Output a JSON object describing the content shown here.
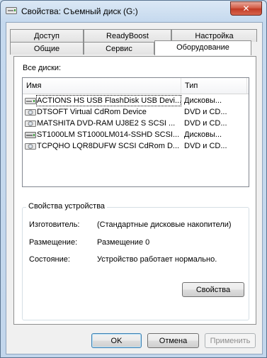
{
  "window": {
    "title": "Свойства: Съемный диск (G:)",
    "close_glyph": "✕"
  },
  "tabs": {
    "row_back": [
      "Доступ",
      "ReadyBoost",
      "Настройка"
    ],
    "row_front": [
      "Общие",
      "Сервис",
      "Оборудование"
    ],
    "active": "Оборудование"
  },
  "hardware": {
    "all_disks_label": "Все диски:",
    "columns": {
      "name": "Имя",
      "type": "Тип"
    },
    "rows": [
      {
        "name": "ACTIONS HS USB FlashDisk USB Devi...",
        "type": "Дисковы...",
        "icon": "usb-disk-icon"
      },
      {
        "name": "DTSOFT Virtual CdRom Device",
        "type": "DVD и CD...",
        "icon": "dvd-drive-icon"
      },
      {
        "name": "MATSHITA DVD-RAM UJ8E2 S SCSI ...",
        "type": "DVD и CD...",
        "icon": "dvd-drive-icon"
      },
      {
        "name": "ST1000LM ST1000LM014-SSHD SCSI...",
        "type": "Дисковы...",
        "icon": "hard-disk-icon"
      },
      {
        "name": "TCPQHO LQR8DUFW SCSI CdRom D...",
        "type": "DVD и CD...",
        "icon": "dvd-drive-icon"
      }
    ],
    "selected_index": 0
  },
  "device_props": {
    "group_title": "Свойства устройства",
    "manufacturer_label": "Изготовитель:",
    "manufacturer_value": "(Стандартные дисковые накопители)",
    "location_label": "Размещение:",
    "location_value": "Размещение 0",
    "status_label": "Состояние:",
    "status_value": "Устройство работает нормально.",
    "properties_button": "Свойства"
  },
  "buttons": {
    "ok": "OK",
    "cancel": "Отмена",
    "apply": "Применить"
  }
}
